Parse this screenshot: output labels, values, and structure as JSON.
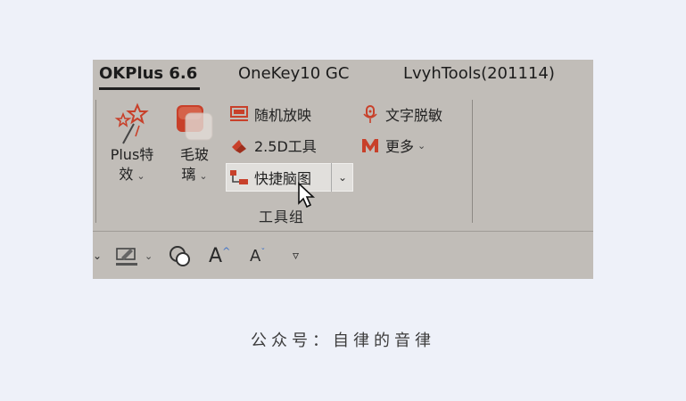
{
  "tabs": [
    {
      "label": "OKPlus 6.6",
      "active": true
    },
    {
      "label": "OneKey10 GC",
      "active": false
    },
    {
      "label": "LvyhTools(201114)",
      "active": false
    }
  ],
  "buttons": {
    "plus_effect": {
      "line1": "Plus特",
      "line2": "效"
    },
    "frosted": {
      "line1": "毛玻",
      "line2": "璃"
    },
    "random_show": "随机放映",
    "two5d": "2.5D工具",
    "mindmap": "快捷脑图",
    "text_desensitize": "文字脱敏",
    "more": "更多"
  },
  "group_label": "工具组",
  "caption": "公众号：自律的音律",
  "colors": {
    "ribbon_bg": "#c1bdb8",
    "accent_red": "#c8402a",
    "page_bg": "#eef1f9"
  },
  "icons": [
    "magic-wand-icon",
    "frosted-glass-icon",
    "slideshow-icon",
    "shape-3d-icon",
    "mindmap-icon",
    "microphone-icon",
    "m-icon",
    "pen-color-icon",
    "shape-outline-icon",
    "font-increase-icon",
    "font-decrease-icon",
    "customize-qat-icon"
  ]
}
